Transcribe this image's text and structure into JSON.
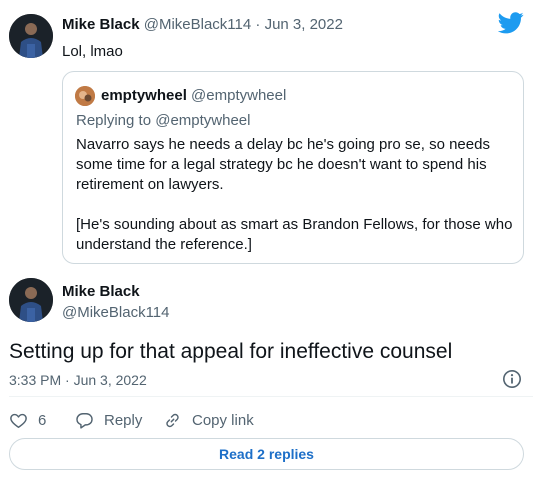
{
  "parent_tweet": {
    "author_name": "Mike Black",
    "author_handle": "@MikeBlack114",
    "separator": "·",
    "date": "Jun 3, 2022",
    "text": "Lol, lmao"
  },
  "quoted_tweet": {
    "author_name": "emptywheel",
    "author_handle": "@emptywheel",
    "replying_to": "Replying to @emptywheel",
    "paragraphs": [
      "Navarro says he needs a delay bc he's going pro se, so needs some time for a legal strategy bc he doesn't want to spend his retirement on lawyers.",
      "[He's sounding about as smart as Brandon Fellows, for those who understand the reference.]"
    ]
  },
  "main_tweet": {
    "author_name": "Mike Black",
    "author_handle": "@MikeBlack114",
    "text": "Setting up for that appeal for ineffective counsel",
    "timestamp": "3:33 PM · Jun 3, 2022"
  },
  "actions": {
    "like_count": "6",
    "reply_label": "Reply",
    "copy_link_label": "Copy link"
  },
  "read_replies_label": "Read 2 replies",
  "icons": {
    "brand": "twitter-bird-icon",
    "info": "info-icon",
    "like": "heart-icon",
    "reply": "speech-bubble-icon",
    "copy": "link-icon"
  },
  "colors": {
    "twitter_blue": "#1d9bf0",
    "link_blue": "#1d6fc8",
    "muted_text": "#536471",
    "border": "#cfd9de"
  }
}
